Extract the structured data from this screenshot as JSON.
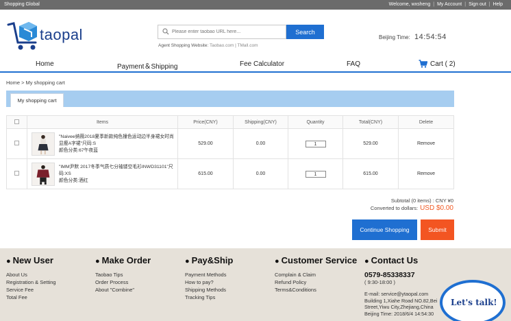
{
  "topbar": {
    "site_name": "Shopping Global",
    "welcome": "Welcome, wxsheng",
    "sep": "|",
    "my_account": "My Account",
    "sign_out": "Sign out",
    "help": "Help"
  },
  "header": {
    "logo_text": "taopal",
    "search_placeholder": "Please enter taobao URL here...",
    "search_button": "Search",
    "agent_label": "Agent Shopping Website:",
    "agent_sites": "Taobao.com | TMall.com",
    "beijing_label": "Beijing Time:",
    "beijing_time": "14:54:54"
  },
  "nav": {
    "home": "Home",
    "payment": "Payment＆Shipping",
    "fee": "Fee Calculator",
    "faq": "FAQ",
    "cart": "Cart ( 2)"
  },
  "breadcrumb": "Home > My shopping cart",
  "tab": "My shopping cart",
  "table": {
    "headers": [
      "Items",
      "Price(CNY)",
      "Shipping(CNY)",
      "Quantity",
      "Total(CNY)",
      "Delete"
    ],
    "rows": [
      {
        "title": "\"Naivee纳薇2018夏季新款纯色撞色运动边半身裙女时尚显瘦A字裙\"尺码:S",
        "color": "颜色分类:67午夜蓝",
        "price": "529.00",
        "shipping": "0.00",
        "qty": "1",
        "total": "529.00",
        "remove": "Remove"
      },
      {
        "title": "\"IMM尹默 2017冬季气质七分袖镂空毛衫INWD31101\"尺码:XS",
        "color": "颜色分类:酒红",
        "price": "615.00",
        "shipping": "0.00",
        "qty": "1",
        "total": "615.00",
        "remove": "Remove"
      }
    ]
  },
  "totals": {
    "subtotal": "Subtotal (0 items) : CNY ¥0",
    "converted_label": "Converted to dollars:",
    "converted_value": "USD $0.00"
  },
  "buttons": {
    "continue": "Continue Shopping",
    "submit": "Submit"
  },
  "footer": {
    "new_user": {
      "title": "New User",
      "links": [
        "About Us",
        "Registration & Setting",
        "Service Fee",
        "Total Fee"
      ]
    },
    "make_order": {
      "title": "Make Order",
      "links": [
        "Taobao Tips",
        "Order Process",
        "About \"Combine\""
      ]
    },
    "pay_ship": {
      "title": "Pay&Ship",
      "links": [
        "Payment Methods",
        "How to pay?",
        "Shipping Methods",
        "Tracking Tips"
      ]
    },
    "customer_service": {
      "title": "Customer Service",
      "links": [
        "Complain & Claim",
        "Refund Policy",
        "Terms&Conditions"
      ]
    },
    "contact": {
      "title": "Contact Us",
      "phone": "0579-85338337",
      "hours": "( 9:30-18:00 )",
      "email": "E-mail: service@ytaopal.com",
      "address1": "Building 1,Xiahe Road NO.82,Bei",
      "address2": "Street,Yiwu City,Zhejiang,China",
      "time": "Beijing Time: 2018/6/4 14:54:30"
    },
    "bullet": "●",
    "talk": "Let's talk!"
  },
  "colors": {
    "primary": "#1f6fd1",
    "accent": "#f35522",
    "tabbar": "#a6cdf0",
    "footer_bg": "#e6e1d9"
  }
}
